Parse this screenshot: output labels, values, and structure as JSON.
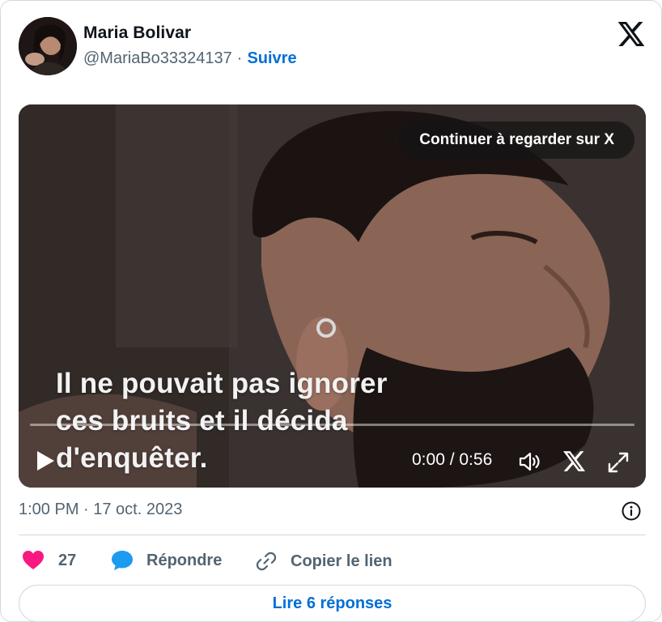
{
  "author": {
    "display_name": "Maria Bolivar",
    "handle": "@MariaBo33324137",
    "separator": "·",
    "follow_label": "Suivre"
  },
  "video": {
    "continue_label": "Continuer à regarder sur X",
    "subtitle_lines": [
      "Il ne pouvait pas ignorer",
      "ces bruits et il décida",
      "d'enquêter."
    ],
    "time_display": "0:00 / 0:56",
    "progress_fraction": 0.0
  },
  "timestamp": "1:00 PM · 17 oct. 2023",
  "actions": {
    "like_count": "27",
    "reply_label": "Répondre",
    "copy_link_label": "Copier le lien"
  },
  "read_replies_label": "Lire 6 réponses",
  "icons": {
    "brand": "x-logo-icon",
    "like": "heart-icon",
    "reply": "speech-bubble-icon",
    "copy": "link-icon",
    "info": "info-icon",
    "play": "play-icon",
    "volume": "volume-icon",
    "fullscreen": "expand-icon"
  },
  "colors": {
    "link_blue": "#006fd6",
    "like_pink": "#f91880",
    "reply_blue": "#1d9bf0",
    "muted_text": "#536471",
    "border": "#cfd9de"
  }
}
